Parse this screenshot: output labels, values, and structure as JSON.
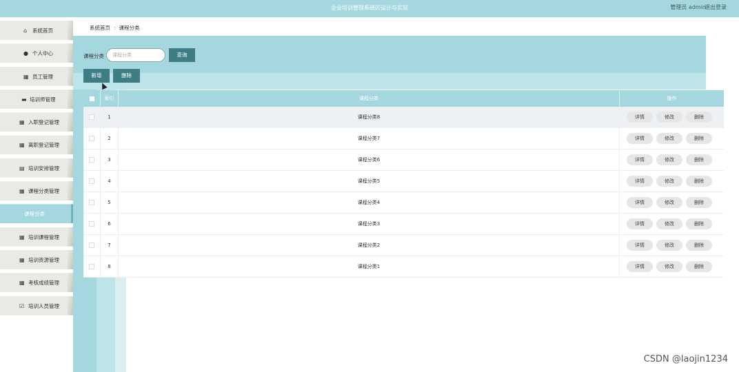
{
  "header": {
    "title": "企业培训管理系统的设计与实现",
    "user": "管理员 admin",
    "logout": "退出登录"
  },
  "sidebar": {
    "items": [
      {
        "label": "系统首页",
        "icon": "home-icon",
        "glyph": "⌂"
      },
      {
        "label": "个人中心",
        "icon": "user-icon",
        "glyph": "●"
      },
      {
        "label": "员工管理",
        "icon": "grid-icon",
        "glyph": "▦"
      },
      {
        "label": "培训师管理",
        "icon": "briefcase-icon",
        "glyph": "▬"
      },
      {
        "label": "入职登记管理",
        "icon": "grid-icon",
        "glyph": "▦"
      },
      {
        "label": "离职登记管理",
        "icon": "grid-icon",
        "glyph": "▦"
      },
      {
        "label": "培训安排管理",
        "icon": "clipboard-icon",
        "glyph": "▤"
      },
      {
        "label": "课程分类管理",
        "icon": "grid-icon",
        "glyph": "▦"
      },
      {
        "label": "课程分类",
        "icon": "",
        "glyph": ""
      },
      {
        "label": "培训课程管理",
        "icon": "grid-icon",
        "glyph": "▦"
      },
      {
        "label": "培训资源管理",
        "icon": "grid-icon",
        "glyph": "▦"
      },
      {
        "label": "考核成绩管理",
        "icon": "grid-icon",
        "glyph": "▦"
      },
      {
        "label": "培训人员管理",
        "icon": "checkbox-icon",
        "glyph": "☑"
      }
    ]
  },
  "breadcrumb": {
    "home": "系统首页",
    "separator": ":",
    "current": "课程分类"
  },
  "search": {
    "label": "课程分类",
    "placeholder": "课程分类",
    "button": "查询"
  },
  "actions": {
    "add": "新增",
    "delete": "删除"
  },
  "table": {
    "headers": {
      "index": "索引",
      "name": "课程分类",
      "ops": "操作"
    },
    "rows": [
      {
        "index": "1",
        "name": "课程分类8"
      },
      {
        "index": "2",
        "name": "课程分类7"
      },
      {
        "index": "3",
        "name": "课程分类6"
      },
      {
        "index": "4",
        "name": "课程分类5"
      },
      {
        "index": "5",
        "name": "课程分类4"
      },
      {
        "index": "6",
        "name": "课程分类3"
      },
      {
        "index": "7",
        "name": "课程分类2"
      },
      {
        "index": "8",
        "name": "课程分类1"
      }
    ],
    "row_actions": {
      "detail": "详情",
      "edit": "修改",
      "delete": "删除"
    }
  },
  "watermark": "CSDN @laojin1234",
  "colors": {
    "accent": "#a4d8de",
    "button": "#3d7d83",
    "light": "#bde4e8"
  }
}
